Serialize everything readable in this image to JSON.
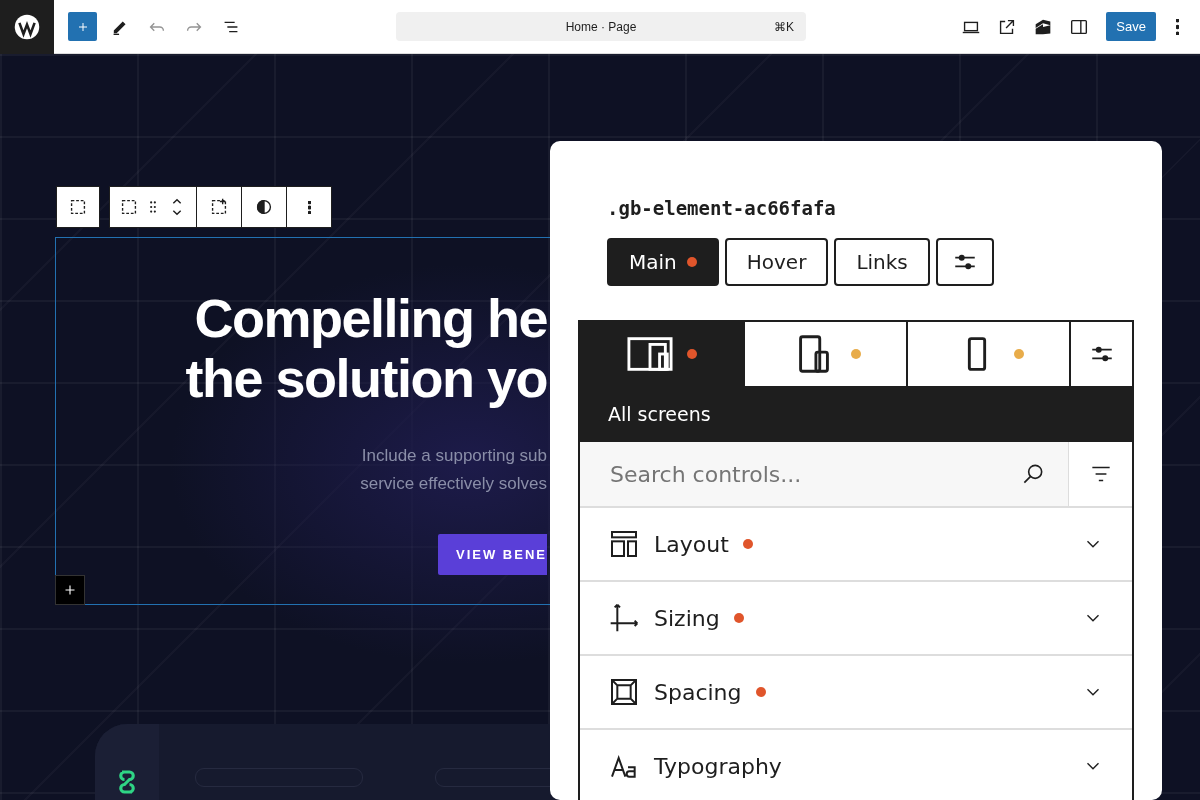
{
  "topbar": {
    "command": {
      "title": "Home · Page",
      "shortcut": "⌘K"
    },
    "save": "Save"
  },
  "canvas": {
    "heading": [
      "Compelling he",
      "the solution yo"
    ],
    "subheading": [
      "Include a supporting sub",
      "service effectively solves"
    ],
    "button": "VIEW BENE"
  },
  "panel": {
    "selector": ".gb-element-ac66fafa",
    "states": [
      {
        "label": "Main",
        "selected": true,
        "modified": true
      },
      {
        "label": "Hover",
        "selected": false,
        "modified": false
      },
      {
        "label": "Links",
        "selected": false,
        "modified": false
      }
    ],
    "devices": [
      {
        "kind": "all",
        "selected": true,
        "color": "#e0552b"
      },
      {
        "kind": "tablet",
        "selected": false,
        "color": "#e8ac4a"
      },
      {
        "kind": "mobile",
        "selected": false,
        "color": "#e8ac4a"
      }
    ],
    "device_label": "All screens",
    "search": {
      "placeholder": "Search controls..."
    },
    "sections": [
      {
        "kind": "layout",
        "label": "Layout",
        "modified": true
      },
      {
        "kind": "sizing",
        "label": "Sizing",
        "modified": true
      },
      {
        "kind": "spacing",
        "label": "Spacing",
        "modified": true
      },
      {
        "kind": "typography",
        "label": "Typography",
        "modified": false
      }
    ]
  }
}
